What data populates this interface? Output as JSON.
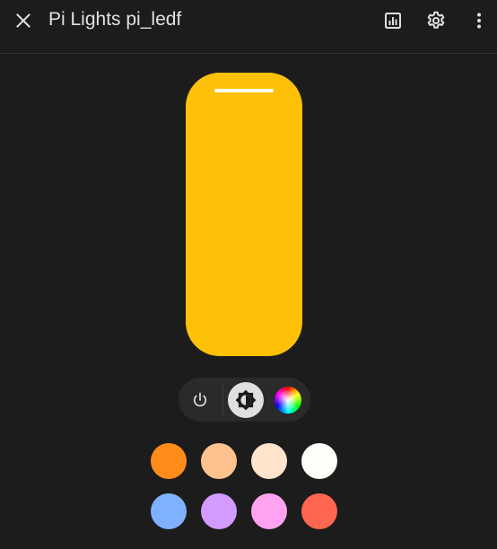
{
  "dialog": {
    "title": "Pi Lights pi_ledf"
  },
  "icons": {
    "close": "close-icon",
    "history": "chart-bar-icon",
    "settings": "gear-icon",
    "more": "dots-vertical-icon",
    "power": "power-icon",
    "brightness": "brightness-icon",
    "color": "color-wheel-icon"
  },
  "brightness": {
    "level": 100,
    "color": "#ffc107",
    "track_color": "#3a3a3a"
  },
  "modes": {
    "active": "brightness"
  },
  "favorite_colors": [
    {
      "color": "#ff8c1a"
    },
    {
      "color": "#ffc28e"
    },
    {
      "color": "#ffe3cc"
    },
    {
      "color": "#fefdf8"
    },
    {
      "color": "#7fb1ff"
    },
    {
      "color": "#d39bff"
    },
    {
      "color": "#ffa3f0"
    },
    {
      "color": "#ff6651"
    }
  ]
}
